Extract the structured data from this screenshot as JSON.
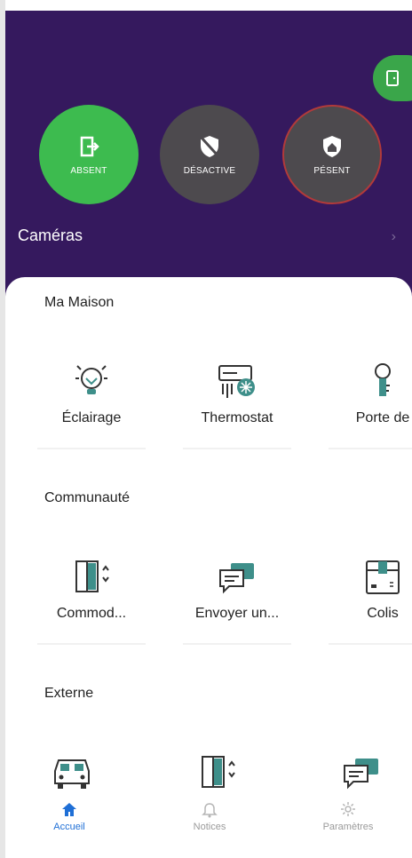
{
  "header": {
    "modes": [
      {
        "label": "ABSENT",
        "icon": "exit-door-icon"
      },
      {
        "label": "DÉSACTIVE",
        "icon": "shield-off-icon"
      },
      {
        "label": "PÉSENT",
        "icon": "home-shield-icon"
      }
    ],
    "cameras_label": "Caméras",
    "door_icon": "door-icon"
  },
  "sections": [
    {
      "title": "Ma Maison",
      "items": [
        {
          "label": "Éclairage",
          "icon": "lightbulb-icon"
        },
        {
          "label": "Thermostat",
          "icon": "ac-unit-icon"
        },
        {
          "label": "Porte de",
          "icon": "key-icon"
        }
      ]
    },
    {
      "title": "Communauté",
      "items": [
        {
          "label": "Commod...",
          "icon": "elevator-icon"
        },
        {
          "label": "Envoyer un...",
          "icon": "chat-icon"
        },
        {
          "label": "Colis",
          "icon": "package-icon"
        }
      ]
    },
    {
      "title": "Externe",
      "items": [
        {
          "label": "",
          "icon": "car-icon"
        },
        {
          "label": "",
          "icon": "elevator-icon"
        },
        {
          "label": "",
          "icon": "chat-icon"
        }
      ]
    }
  ],
  "nav": [
    {
      "label": "Accueil",
      "icon": "home-icon",
      "active": true
    },
    {
      "label": "Notices",
      "icon": "bell-icon",
      "active": false
    },
    {
      "label": "Paramètres",
      "icon": "gear-icon",
      "active": false
    }
  ],
  "colors": {
    "header": "#35195e",
    "green": "#3dbb4f",
    "teal": "#3e8f8a",
    "active": "#1f6fd6"
  }
}
